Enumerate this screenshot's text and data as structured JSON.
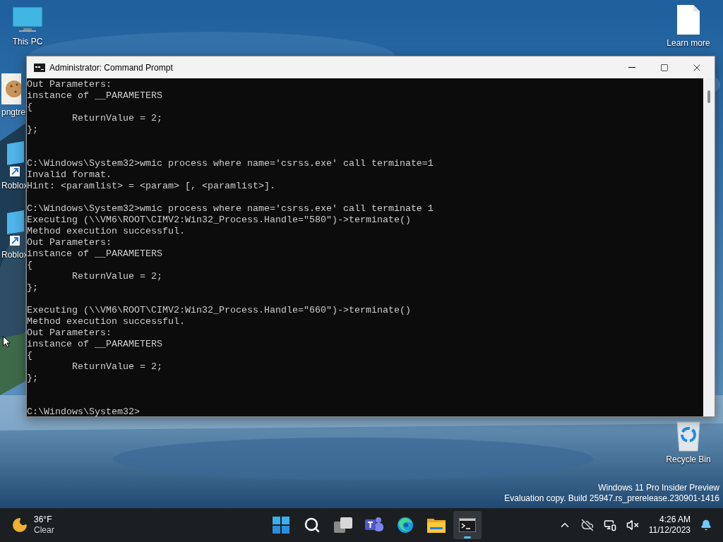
{
  "desktop_icons": [
    {
      "kind": "computer",
      "label": "This PC"
    },
    {
      "label": "pngtre"
    },
    {
      "kind": "shortcut",
      "label": "Roblox"
    },
    {
      "kind": "shortcut",
      "label": "Roblox"
    },
    {
      "kind": "document",
      "label": "Learn more"
    },
    {
      "kind": "recycle",
      "label": "Recycle Bin"
    }
  ],
  "window": {
    "title": "Administrator: Command Prompt",
    "console": "Out Parameters:\ninstance of __PARAMETERS\n{\n        ReturnValue = 2;\n};\n\n\nC:\\Windows\\System32>wmic process where name='csrss.exe' call terminate=1\nInvalid format.\nHint: <paramlist> = <param> [, <paramlist>].\n\nC:\\Windows\\System32>wmic process where name='csrss.exe' call terminate 1\nExecuting (\\\\VM6\\ROOT\\CIMV2:Win32_Process.Handle=\"580\")->terminate()\nMethod execution successful.\nOut Parameters:\ninstance of __PARAMETERS\n{\n        ReturnValue = 2;\n};\n\nExecuting (\\\\VM6\\ROOT\\CIMV2:Win32_Process.Handle=\"660\")->terminate()\nMethod execution successful.\nOut Parameters:\ninstance of __PARAMETERS\n{\n        ReturnValue = 2;\n};\n\n\nC:\\Windows\\System32>"
  },
  "watermark": [
    "Windows 11 Pro Insider Preview",
    "Evaluation copy. Build 25947.rs_prerelease.230901-1416"
  ],
  "taskbar": {
    "weather": {
      "temperature": "36°F",
      "condition": "Clear"
    },
    "apps": [
      {
        "kind": "start",
        "active": false
      },
      {
        "kind": "search",
        "active": false
      },
      {
        "kind": "taskview",
        "active": false
      },
      {
        "kind": "teams",
        "active": false
      },
      {
        "kind": "edge",
        "active": false
      },
      {
        "kind": "explorer",
        "active": false
      },
      {
        "kind": "console",
        "active": true
      }
    ],
    "tray": [
      {
        "kind": "chevron"
      },
      {
        "kind": "cloud-off"
      },
      {
        "kind": "network"
      },
      {
        "kind": "volume-muted"
      }
    ],
    "time": "4:26 AM",
    "date": "11/12/2023"
  }
}
